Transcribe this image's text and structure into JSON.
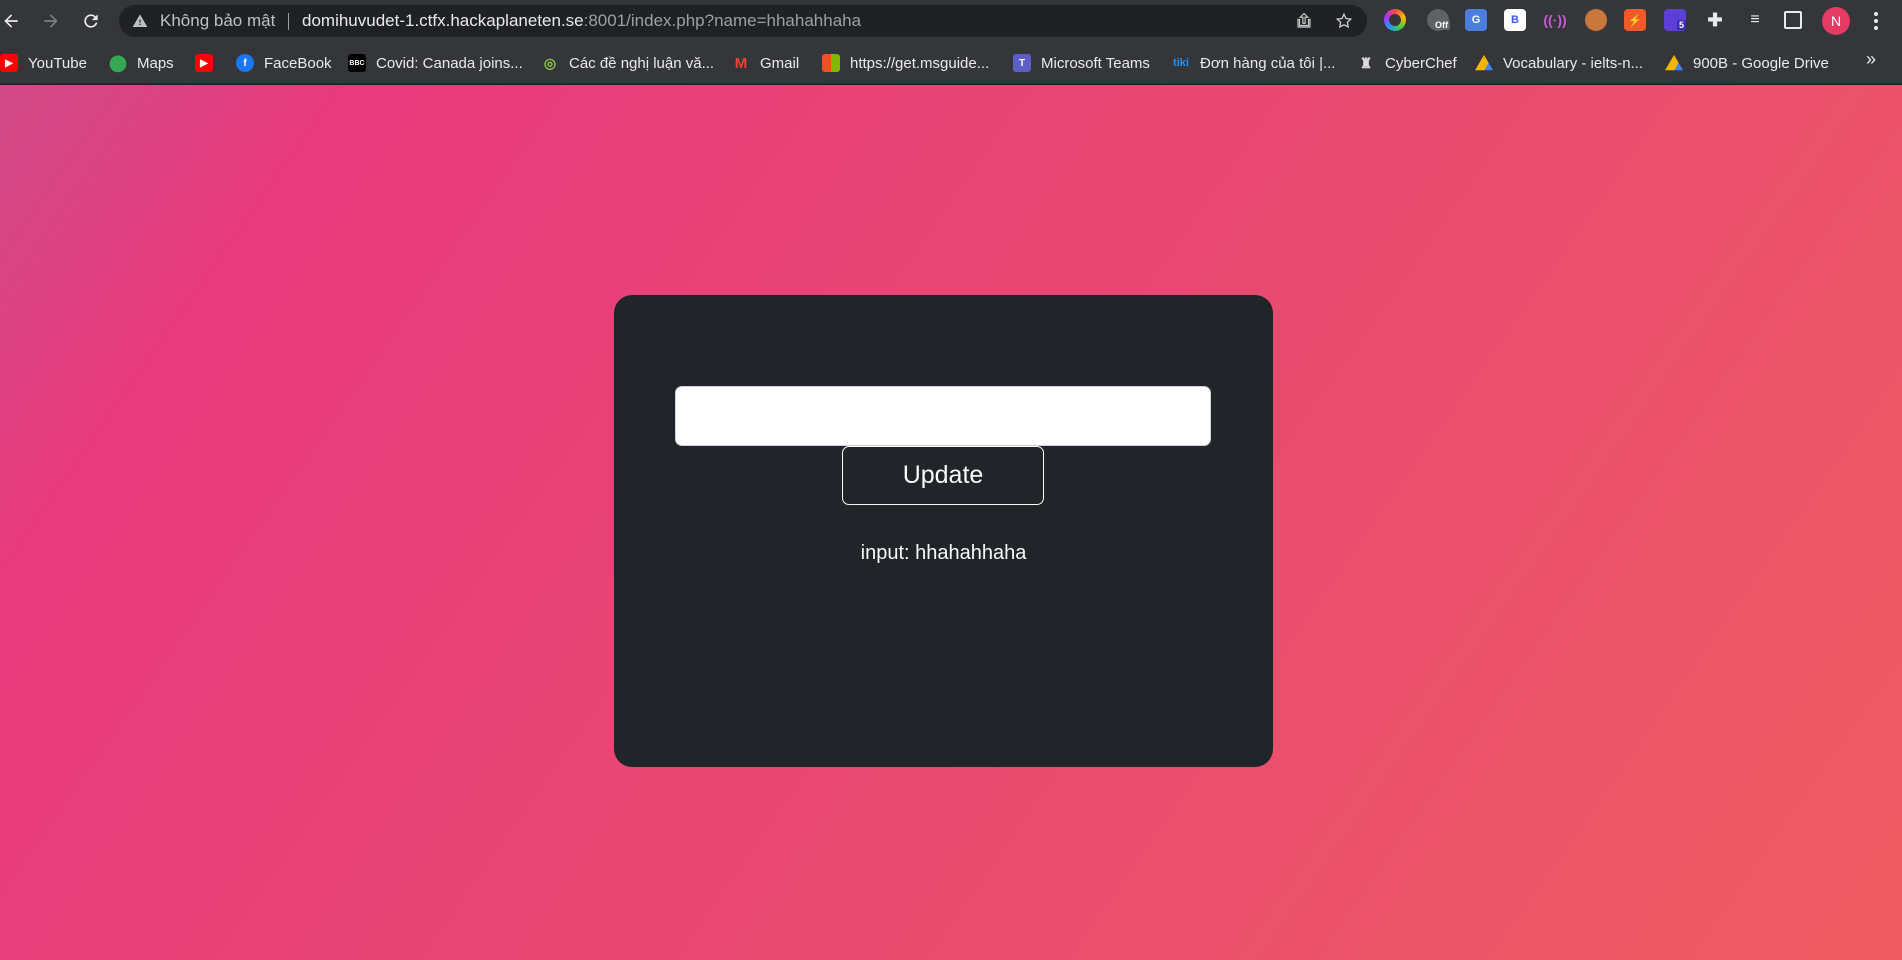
{
  "browser": {
    "security_label": "Không bảo mật",
    "url_host": "domihuvudet-1.ctfx.hackaplaneten.se",
    "url_rest": ":8001/index.php?name=hhahahhaha",
    "profile_initial": "N",
    "extension_badge": "5",
    "off_badge": "Off"
  },
  "bookmarks": [
    {
      "label": "YouTube",
      "icon": "youtube-icon"
    },
    {
      "label": "Maps",
      "icon": "maps-icon"
    },
    {
      "label": "",
      "icon": "youtube-icon"
    },
    {
      "label": "FaceBook",
      "icon": "facebook-icon"
    },
    {
      "label": "Covid: Canada joins...",
      "icon": "bbc-icon"
    },
    {
      "label": "Các đề nghị luận vă...",
      "icon": "owl-icon"
    },
    {
      "label": "Gmail",
      "icon": "gmail-icon"
    },
    {
      "label": "https://get.msguide...",
      "icon": "ms-icon"
    },
    {
      "label": "Microsoft Teams",
      "icon": "teams-icon"
    },
    {
      "label": "Đơn hàng của tôi |...",
      "icon": "tiki-icon"
    },
    {
      "label": "CyberChef",
      "icon": "chef-icon"
    },
    {
      "label": "Vocabulary - ielts-n...",
      "icon": "drive-icon"
    },
    {
      "label": "900B - Google Drive",
      "icon": "drive-icon"
    }
  ],
  "form": {
    "input_value": "",
    "button_label": "Update",
    "output_text": "input: hhahahhaha"
  },
  "colors": {
    "card_bg": "#212529",
    "gradient_start": "#d04a86",
    "gradient_end": "#ee5c61"
  }
}
